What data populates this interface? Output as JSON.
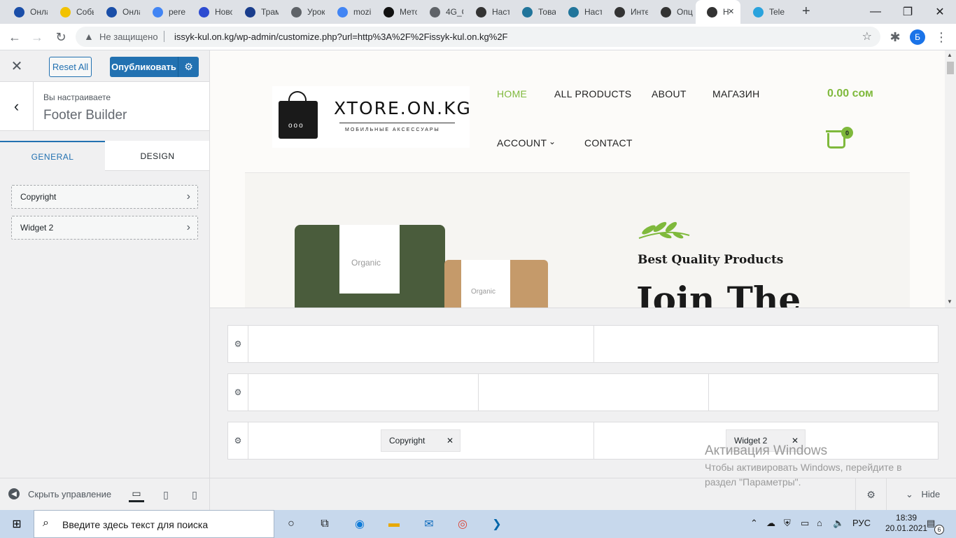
{
  "browser": {
    "tabs": [
      {
        "title": "Онла",
        "icon": "heart-icon",
        "color": "#1a4ea8"
      },
      {
        "title": "Собы",
        "icon": "lemon-icon",
        "color": "#f2c200"
      },
      {
        "title": "Онла",
        "icon": "heart-icon",
        "color": "#1a4ea8"
      },
      {
        "title": "pere",
        "icon": "google-icon",
        "color": "#4285f4"
      },
      {
        "title": "Ново",
        "icon": "circle-logo-icon",
        "color": "#2c4bd1"
      },
      {
        "title": "Трам",
        "icon": "window-icon",
        "color": "#1a3d8c"
      },
      {
        "title": "Урок",
        "icon": "globe-icon",
        "color": "#5f6368"
      },
      {
        "title": "mozi",
        "icon": "google-icon",
        "color": "#4285f4"
      },
      {
        "title": "Мето",
        "icon": "arrow-logo-icon",
        "color": "#111111"
      },
      {
        "title": "4G_C",
        "icon": "globe-icon",
        "color": "#5f6368"
      },
      {
        "title": "Наст",
        "icon": "site-icon",
        "color": "#333333"
      },
      {
        "title": "Това",
        "icon": "wordpress-icon",
        "color": "#21759b"
      },
      {
        "title": "Наст",
        "icon": "wordpress-icon",
        "color": "#21759b"
      },
      {
        "title": "Инте",
        "icon": "site-icon",
        "color": "#333333"
      },
      {
        "title": "Опц",
        "icon": "site-icon",
        "color": "#333333"
      },
      {
        "title": "Н",
        "icon": "site-icon",
        "color": "#333333",
        "active": true
      },
      {
        "title": "Tele",
        "icon": "telegram-icon",
        "color": "#2aa3dd"
      }
    ],
    "new_tab": "+",
    "window_controls": {
      "minimize": "—",
      "maximize": "❐",
      "close": "✕"
    },
    "address": {
      "security_label": "Не защищено",
      "url": "issyk-kul.on.kg/wp-admin/customize.php?url=http%3A%2F%2Fissyk-kul.on.kg%2F"
    },
    "profile_initial": "Б"
  },
  "customizer": {
    "reset_label": "Reset All",
    "publish_label": "Опубликовать",
    "customizing_label": "Вы настраиваете",
    "panel_title": "Footer Builder",
    "tabs": [
      "GENERAL",
      "DESIGN"
    ],
    "items": [
      "Copyright",
      "Widget 2"
    ],
    "hide_controls_label": "Скрыть управление"
  },
  "site": {
    "logo_text": "XTORE.ON.KG",
    "logo_subtitle": "МОБИЛЬНЫЕ АКСЕССУАРЫ",
    "logo_bag_dots": "ooo",
    "nav": [
      "HOME",
      "ALL PRODUCTS",
      "ABOUT",
      "МАГАЗИН",
      "ACCOUNT",
      "CONTACT"
    ],
    "cart_total": "0.00 сом",
    "cart_count": "0",
    "product_label_1": "Organic",
    "product_label_2": "Organic",
    "hero_tagline": "Best Quality Products",
    "hero_title": "Join The",
    "accent_color": "#7fb93c"
  },
  "builder": {
    "chips": [
      "Copyright",
      "Widget 2"
    ],
    "hide_label": "Hide"
  },
  "windows_activation": {
    "title": "Активация Windows",
    "text": "Чтобы активировать Windows, перейдите в раздел \"Параметры\"."
  },
  "taskbar": {
    "search_placeholder": "Введите здесь текст для поиска",
    "language": "РУС",
    "time": "18:39",
    "date": "20.01.2021",
    "notification_count": "6"
  }
}
